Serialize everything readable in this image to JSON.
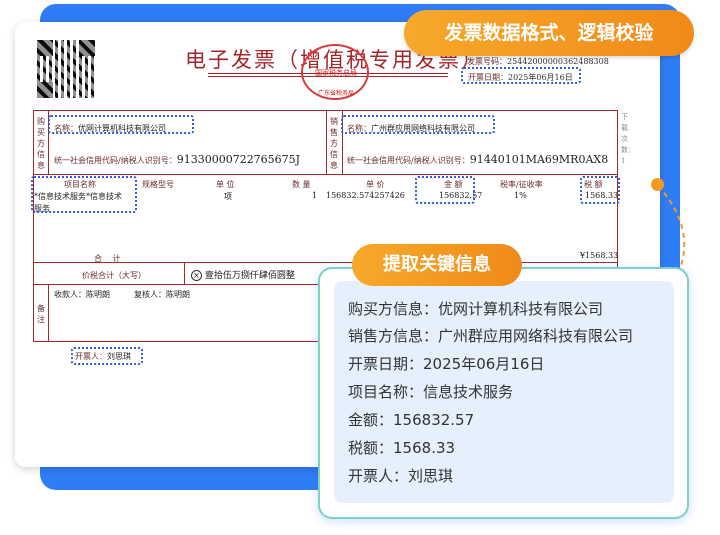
{
  "badges": {
    "top": "发票数据格式、逻辑校验",
    "extract": "提取关键信息"
  },
  "invoice": {
    "title": "电子发票（增值税专用发票）",
    "seal_line1": "国家税务总局",
    "seal_line2": "广东省税务局",
    "number_label": "发票号码：",
    "number": "25442000000362488308",
    "date_label": "开票日期：",
    "date": "2025年06月16日",
    "buyer_vertical": "购买方信息",
    "seller_vertical": "销售方信息",
    "buyer_name_label": "名称：",
    "buyer_name": "优网计算机科技有限公司",
    "buyer_tax_label": "统一社会信用代码/纳税人识别号：",
    "buyer_tax": "91330000722765675J",
    "seller_name_label": "名称：",
    "seller_name": "广州群应用网络科技有限公司",
    "seller_tax_label": "统一社会信用代码/纳税人识别号：",
    "seller_tax": "91440101MA69MR0AX8",
    "headers": {
      "item": "项目名称",
      "spec": "规格型号",
      "unit": "单 位",
      "qty": "数 量",
      "price": "单 价",
      "amount": "金 额",
      "rate": "税率/征收率",
      "tax": "税 额"
    },
    "row": {
      "item_line1": "*信息技术服务*信息技术",
      "item_line2": "服务",
      "unit": "项",
      "qty": "1",
      "price": "156832.574257426",
      "amount": "156832.57",
      "rate": "1%",
      "tax": "1568.33"
    },
    "total_label": "合 计",
    "total_tax": "¥1568.33",
    "grand_label": "价税合计（大写）",
    "grand_words": "壹拾伍万捌仟肆佰圆整",
    "remark_vertical": "备注",
    "payee_label": "收款人：",
    "payee": "陈明朗",
    "reviewer_label": "复核人：",
    "reviewer": "陈明朗",
    "drawer_label": "开票人：",
    "drawer": "刘思琪",
    "side_note": "下载次数：1"
  },
  "extracted": [
    {
      "label": "购买方信息：",
      "value": "优网计算机科技有限公司"
    },
    {
      "label": "销售方信息：",
      "value": "广州群应用网络科技有限公司"
    },
    {
      "label": "开票日期：",
      "value": "2025年06月16日"
    },
    {
      "label": "项目名称：",
      "value": "信息技术服务"
    },
    {
      "label": "金额：",
      "value": "156832.57"
    },
    {
      "label": "税额：",
      "value": "1568.33"
    },
    {
      "label": "开票人：",
      "value": "刘思琪"
    }
  ],
  "colors": {
    "accent_blue": "#2f7df6",
    "badge_orange": "#f39a1e",
    "invoice_red": "#a3262a",
    "highlight_dash": "#2f5fd0"
  }
}
